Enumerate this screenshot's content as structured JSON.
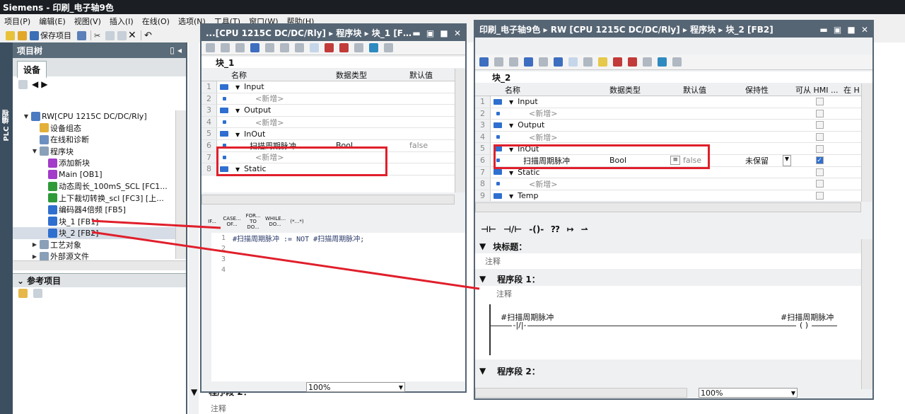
{
  "app_title": "Siemens  -  印刷_电子轴9色",
  "menu": [
    "项目(P)",
    "编辑(E)",
    "视图(V)",
    "插入(I)",
    "在线(O)",
    "选项(N)",
    "工具(T)",
    "窗口(W)",
    "帮助(H)"
  ],
  "toolbar": {
    "save_label": "保存项目"
  },
  "left_strip_label": "PLC 编程",
  "project_tree": {
    "title": "项目树",
    "tab": "设备",
    "items": [
      "RW[CPU 1215C DC/DC/Rly]",
      "设备组态",
      "在线和诊断",
      "程序块",
      "添加新块",
      "Main [OB1]",
      "动态周长_100mS_SCL [FC1...",
      "上下裁切转换_scl [FC3] [上...",
      "编码器4倍频 [FB5]",
      "块_1 [FB1]",
      "块_2 [FB2]",
      "工艺对象",
      "外部源文件"
    ],
    "ref_title": "参考项目"
  },
  "win1": {
    "title": "...[CPU 1215C DC/DC/Rly]  ▸  程序块  ▸  块_1 [FB1]",
    "block_name": "块_1",
    "headers": [
      "名称",
      "数据类型",
      "默认值"
    ],
    "rows": [
      {
        "n": "1",
        "name": "Input",
        "type": "",
        "def": ""
      },
      {
        "n": "2",
        "name": "<新增>",
        "type": "",
        "def": ""
      },
      {
        "n": "3",
        "name": "Output",
        "type": "",
        "def": ""
      },
      {
        "n": "4",
        "name": "<新增>",
        "type": "",
        "def": ""
      },
      {
        "n": "5",
        "name": "InOut",
        "type": "",
        "def": ""
      },
      {
        "n": "6",
        "name": "扫描周期脉冲",
        "type": "Bool",
        "def": "false"
      },
      {
        "n": "7",
        "name": "<新增>",
        "type": "",
        "def": ""
      },
      {
        "n": "8",
        "name": "Static",
        "type": "",
        "def": ""
      }
    ],
    "scl_buttons": [
      "IF...",
      "CASE... OF...",
      "FOR... TO DO...",
      "WHILE... DO...",
      "(*...*)"
    ],
    "code_lines": [
      {
        "n": "1",
        "text": "#扫描周期脉冲 := NOT #扫描周期脉冲;"
      },
      {
        "n": "2",
        "text": ""
      },
      {
        "n": "3",
        "text": ""
      },
      {
        "n": "4",
        "text": ""
      }
    ],
    "zoom": "100%"
  },
  "win2": {
    "title": "印刷_电子轴9色  ▸  RW [CPU 1215C DC/DC/Rly]  ▸  程序块  ▸  块_2 [FB2]",
    "block_name": "块_2",
    "headers": [
      "名称",
      "数据类型",
      "默认值",
      "保持性",
      "可从 HMI ...",
      "在 H"
    ],
    "rows": [
      {
        "n": "1",
        "name": "Input",
        "type": "",
        "def": "",
        "ret": ""
      },
      {
        "n": "2",
        "name": "<新增>",
        "type": "",
        "def": "",
        "ret": ""
      },
      {
        "n": "3",
        "name": "Output",
        "type": "",
        "def": "",
        "ret": ""
      },
      {
        "n": "4",
        "name": "<新增>",
        "type": "",
        "def": "",
        "ret": ""
      },
      {
        "n": "5",
        "name": "InOut",
        "type": "",
        "def": "",
        "ret": ""
      },
      {
        "n": "6",
        "name": "扫描周期脉冲",
        "type": "Bool",
        "def": "false",
        "ret": "未保留"
      },
      {
        "n": "7",
        "name": "Static",
        "type": "",
        "def": "",
        "ret": ""
      },
      {
        "n": "8",
        "name": "<新增>",
        "type": "",
        "def": "",
        "ret": ""
      },
      {
        "n": "9",
        "name": "Temp",
        "type": "",
        "def": "",
        "ret": ""
      }
    ],
    "block_title": "块标题：",
    "comment": "注释",
    "network1": "程序段 1：",
    "contact_label": "#扫描周期脉冲",
    "coil_label": "#扫描周期脉冲",
    "network2": "程序段 2：",
    "zoom": "100%"
  },
  "bg": {
    "network2": "程序段 2：",
    "comment": "注释"
  }
}
